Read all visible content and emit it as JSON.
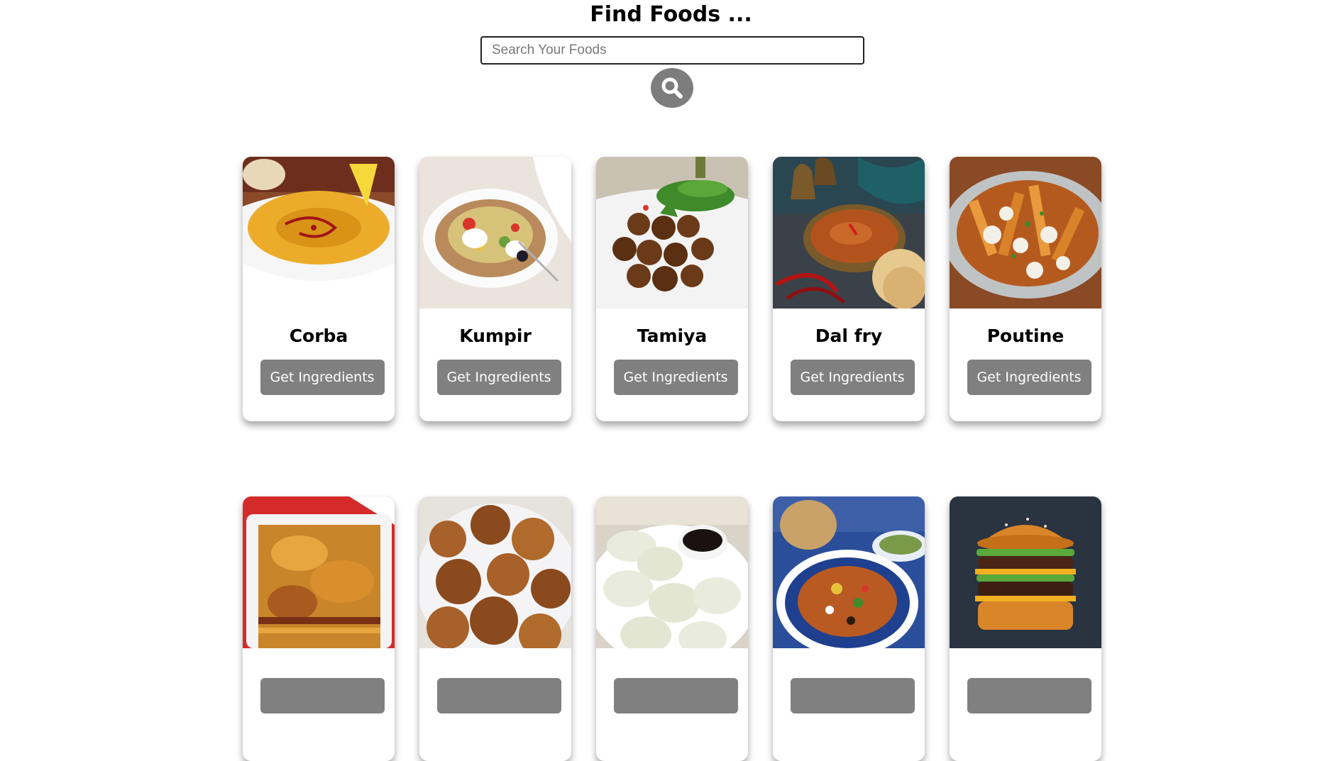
{
  "header": {
    "title": "Find Foods ..."
  },
  "search": {
    "placeholder": "Search Your Foods",
    "value": ""
  },
  "meals": [
    {
      "name": "Corba",
      "button": "Get Ingredients"
    },
    {
      "name": "Kumpir",
      "button": "Get Ingredients"
    },
    {
      "name": "Tamiya",
      "button": "Get Ingredients"
    },
    {
      "name": "Dal fry",
      "button": "Get Ingredients"
    },
    {
      "name": "Poutine",
      "button": "Get Ingredients"
    },
    {
      "name": "",
      "button": ""
    },
    {
      "name": "",
      "button": ""
    },
    {
      "name": "",
      "button": ""
    },
    {
      "name": "",
      "button": ""
    },
    {
      "name": "",
      "button": ""
    }
  ],
  "colors": {
    "button": "#808080",
    "search_button": "#7d7d7d",
    "border": "#222222"
  }
}
